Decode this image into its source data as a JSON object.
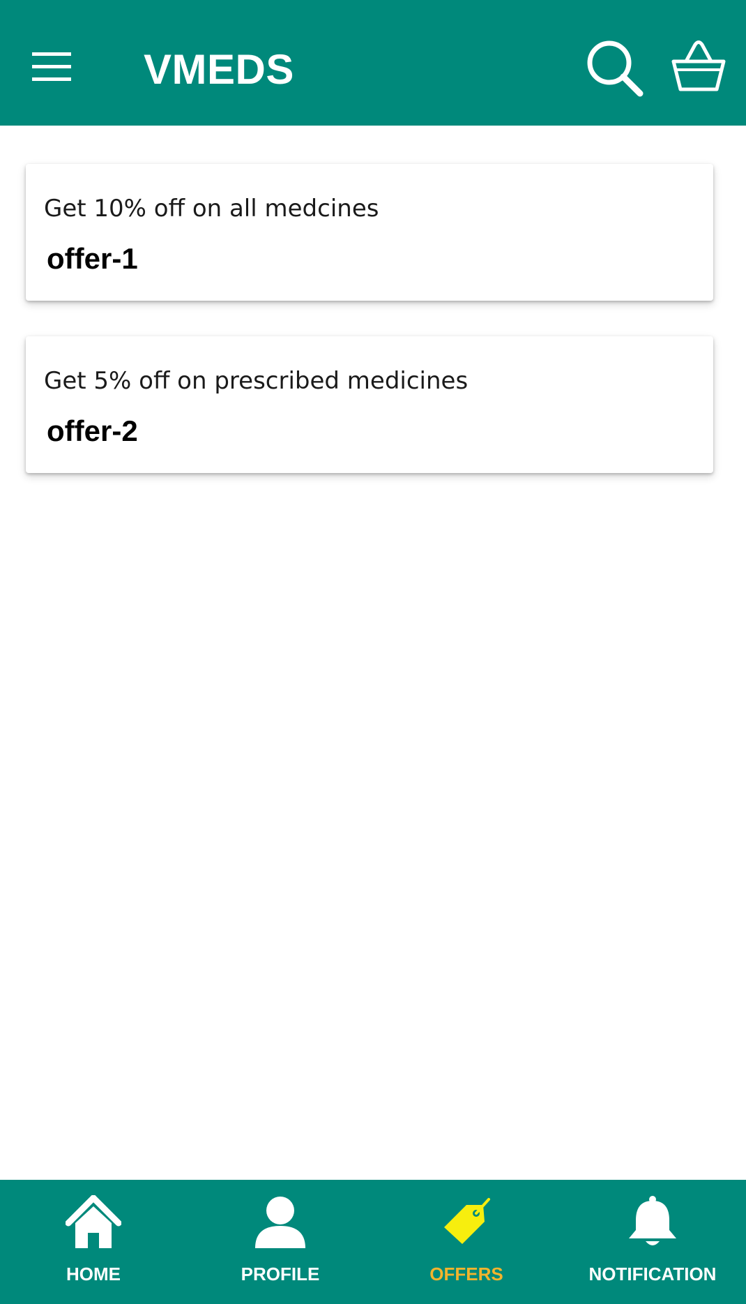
{
  "app": {
    "title": "VMEDS"
  },
  "colors": {
    "primary": "#00897b",
    "active_label": "#f2b42d",
    "active_icon": "#f7ee0e"
  },
  "header": {
    "icons": [
      "menu-icon",
      "search-icon",
      "cart-icon"
    ]
  },
  "offers": [
    {
      "description": "Get 10% off on all medcines",
      "name": "offer-1"
    },
    {
      "description": "Get 5% off on prescribed medicines",
      "name": "offer-2"
    }
  ],
  "bottom_nav": {
    "items": [
      {
        "label": "HOME",
        "icon": "home-icon",
        "active": false
      },
      {
        "label": "PROFILE",
        "icon": "profile-icon",
        "active": false
      },
      {
        "label": "OFFERS",
        "icon": "tag-icon",
        "active": true
      },
      {
        "label": "NOTIFICATION",
        "icon": "bell-icon",
        "active": false
      }
    ]
  }
}
